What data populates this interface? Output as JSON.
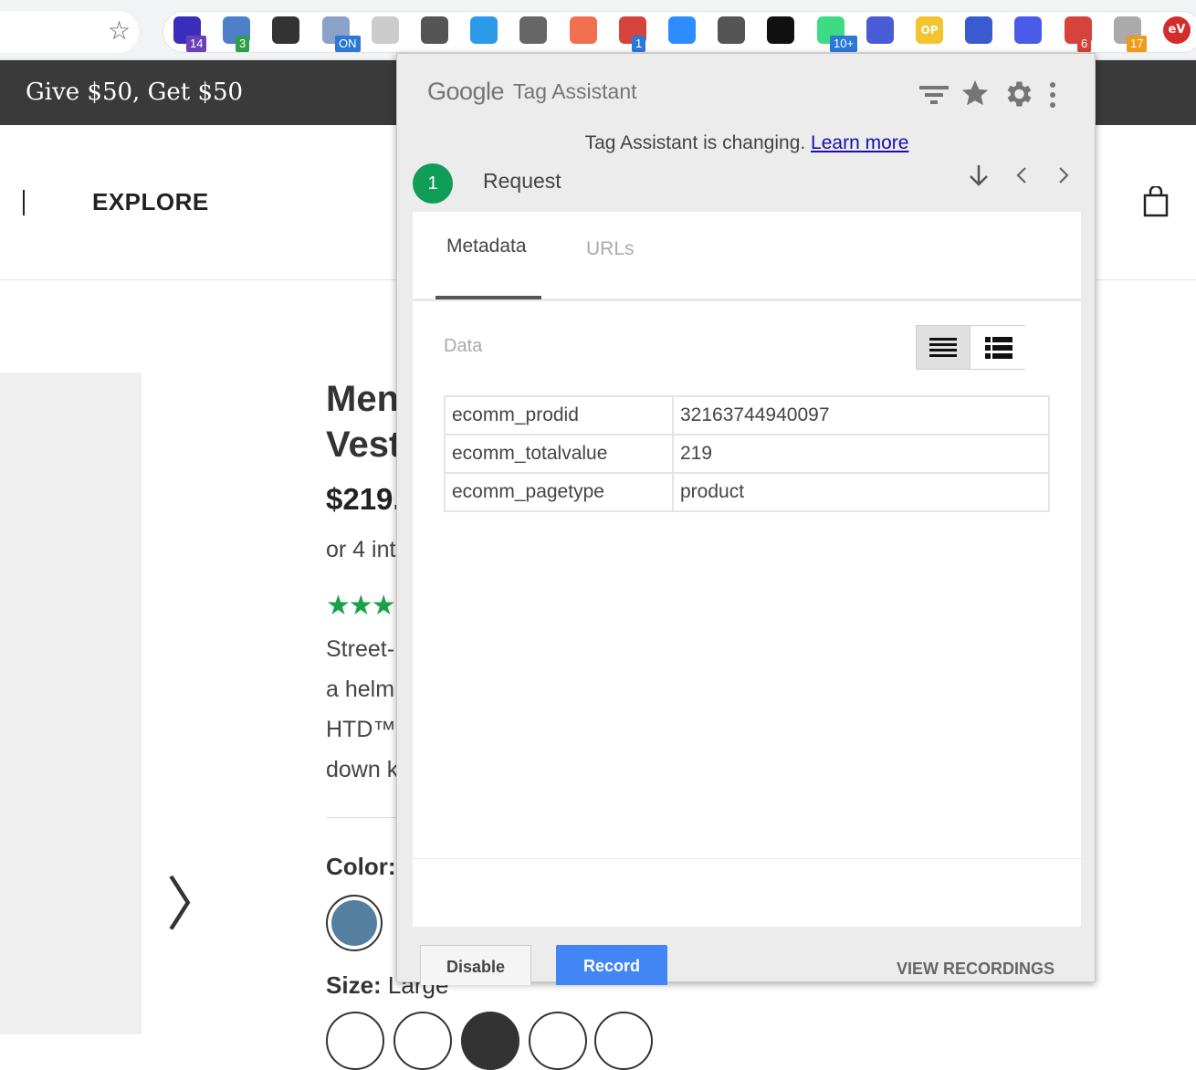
{
  "browser": {
    "extensions": [
      {
        "name": "graduation-cap-icon",
        "badge": "14",
        "badge_color": "#6b3fb8",
        "color": "#3b2dbb"
      },
      {
        "name": "code-tag-icon",
        "badge": "3",
        "badge_color": "#2e9f48",
        "color": "#4f7ecb"
      },
      {
        "name": "info-circle-icon",
        "badge": "",
        "color": "#333333"
      },
      {
        "name": "on-toggle-icon",
        "badge": "ON",
        "badge_color": "#2a78d8",
        "color": "#8aa2c8"
      },
      {
        "name": "leaf-icon",
        "badge": "",
        "color": "#cccccc"
      },
      {
        "name": "tetris-block-icon",
        "badge": "",
        "color": "#555555"
      },
      {
        "name": "bird-icon",
        "badge": "",
        "color": "#2b9be8"
      },
      {
        "name": "arrow-box-icon",
        "badge": "",
        "color": "#666666"
      },
      {
        "name": "hubspot-icon",
        "badge": "",
        "color": "#f07050"
      },
      {
        "name": "double-arrow-icon",
        "badge": "1",
        "badge_color": "#2a78d8",
        "color": "#d6433b"
      },
      {
        "name": "video-camera-icon",
        "badge": "",
        "color": "#2d8cff"
      },
      {
        "name": "globe-arrows-icon",
        "badge": "",
        "color": "#555555"
      },
      {
        "name": "snapchat-ghost-icon",
        "badge": "",
        "color": "#111111"
      },
      {
        "name": "android-icon",
        "badge": "10+",
        "badge_color": "#2a78d8",
        "color": "#3ddc84"
      },
      {
        "name": "dart-circle-icon",
        "badge": "",
        "color": "#4a5bd8"
      },
      {
        "name": "op-icon",
        "badge": "",
        "color": "#f4c430"
      },
      {
        "name": "feather-icon",
        "badge": "",
        "color": "#3a5bd0"
      },
      {
        "name": "snowflake-icon",
        "badge": "",
        "color": "#4a5be8"
      },
      {
        "name": "tag-assistant-icon",
        "badge": "6",
        "badge_color": "#d6433b",
        "color": "#d6433b"
      },
      {
        "name": "ghost-icon",
        "badge": "17",
        "badge_color": "#f09a1a",
        "color": "#aaaaaa"
      },
      {
        "name": "ev-icon",
        "badge": "",
        "color": "#d42b2b"
      }
    ],
    "ev_label": "eV",
    "op_label": "OP"
  },
  "page": {
    "promo": "Give $50, Get $50",
    "nav_explore": "EXPLORE",
    "title_line1": "Men",
    "title_line2": "Vest",
    "price": "$219.",
    "installments": "or 4 int",
    "rating_stars": "★★★",
    "desc": [
      "Street-",
      "a helm",
      "HTD™",
      "down k"
    ],
    "color_label": "Color:",
    "size_label_bold": "Size:",
    "size_value": " Large",
    "carousel_next": "〉",
    "swatch_color": "#557f9f"
  },
  "popup": {
    "logo_google": "Google",
    "logo_app": "Tag Assistant",
    "notice_text": "Tag Assistant is changing. ",
    "notice_link": "Learn more",
    "request_number": "1",
    "request_label": "Request",
    "tabs": {
      "metadata": "Metadata",
      "urls": "URLs"
    },
    "data_label": "Data",
    "rows": [
      {
        "key": "ecomm_prodid",
        "value": "32163744940097"
      },
      {
        "key": "ecomm_totalvalue",
        "value": "219"
      },
      {
        "key": "ecomm_pagetype",
        "value": "product"
      }
    ],
    "buttons": {
      "disable": "Disable",
      "record": "Record",
      "view_recordings": "VIEW RECORDINGS"
    }
  }
}
